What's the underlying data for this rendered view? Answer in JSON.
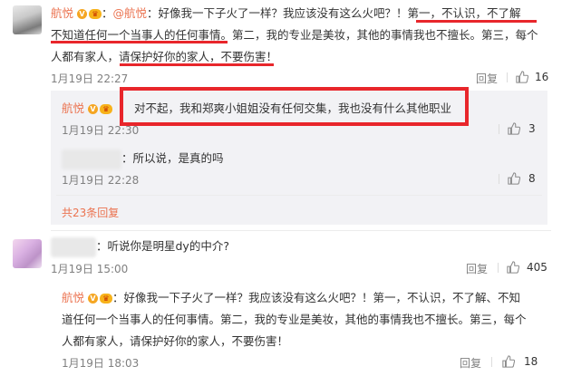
{
  "comments": [
    {
      "user": "航悦",
      "mention": "@航悦",
      "lines": [
        "好像我一下子火了一样？我应该没有这么火吧？！第一，不认识，不了解",
        "不知道任何一个当事人的任何事情。第二，我的专业是美妆，其他的事情我也不擅长。第三，每个",
        "人都有家人，请保护好你的家人，不要伤害！"
      ],
      "time": "1月19日 22:27",
      "reply_label": "回复",
      "likes": "16"
    },
    {
      "reply_user": "航悦",
      "reply_text": "对不起，我和郑爽小姐姐没有任何交集，我也没有什么其他职业",
      "reply_time": "1月19日 22:30",
      "reply_likes": "3",
      "reply2_text": "：所以说，是真的吗",
      "reply2_time": "1月19日 22:28",
      "reply2_likes": "8",
      "more_replies": "共23条回复"
    },
    {
      "text": "：听说你是明星dy的中介?",
      "time": "1月19日 15:00",
      "likes": "405"
    },
    {
      "user": "航悦",
      "lines": [
        "好像我一下子火了一样？我应该没有这么火吧？！第一，不认识，不了解、不知",
        "道任何一个当事人的任何事情。第二，我的专业是美妆，其他的事情我也不擅长。第三，每个",
        "人都有家人，请保护好你的家人，不要伤害！"
      ],
      "time": "1月19日 18:03",
      "likes": "18"
    }
  ],
  "icons": {
    "thumb": "thumbs-up-icon",
    "verified": "verified-badge-icon",
    "medal": "fan-medal-icon"
  },
  "colors": {
    "username": "#eb7350",
    "highlight": "#e8262b",
    "reply_bg": "#f2f2f5"
  }
}
